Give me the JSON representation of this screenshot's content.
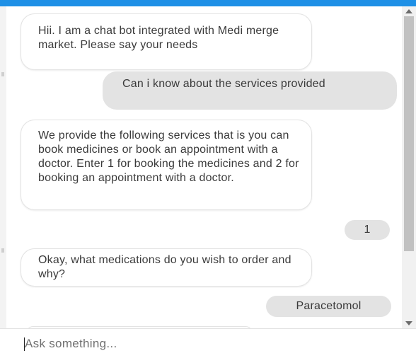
{
  "chat": {
    "messages": [
      {
        "sender": "bot",
        "text": "Hii. I am a chat bot integrated with Medi merge market. Please say your needs"
      },
      {
        "sender": "user",
        "text": "Can i know about the services provided"
      },
      {
        "sender": "bot",
        "text": "We provide the following services that is you can book medicines or book an appointment with a doctor. Enter 1 for booking the medicines and 2 for booking an appointment with a doctor."
      },
      {
        "sender": "user",
        "text": "1"
      },
      {
        "sender": "bot",
        "text": "Okay, what medications do you wish to order and why?"
      },
      {
        "sender": "user",
        "text": "Paracetomol"
      }
    ]
  },
  "input": {
    "placeholder": "Ask something..."
  },
  "colors": {
    "accent": "#1e90e6",
    "user_bubble": "#e3e3e3",
    "bot_bubble": "#ffffff"
  }
}
